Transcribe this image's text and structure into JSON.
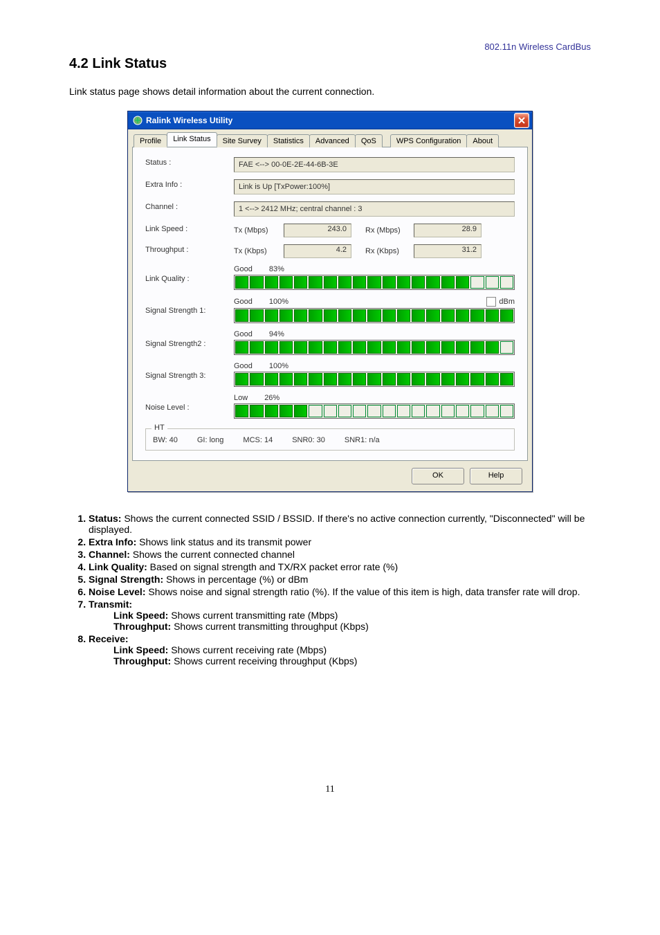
{
  "page": {
    "header": "802.11n Wireless CardBus",
    "section_title": "4.2 Link Status",
    "intro": "Link status page shows detail information about the current connection.",
    "page_number": "11"
  },
  "dialog": {
    "title": "Ralink Wireless Utility",
    "tabs": {
      "profile": "Profile",
      "link_status": "Link Status",
      "site_survey": "Site Survey",
      "statistics": "Statistics",
      "advanced": "Advanced",
      "qos": "QoS",
      "wps": "WPS Configuration",
      "about": "About"
    },
    "labels": {
      "status": "Status :",
      "extra": "Extra Info :",
      "channel": "Channel :",
      "linkspeed": "Link Speed :",
      "throughput": "Throughput :",
      "quality": "Link Quality :",
      "ss1": "Signal Strength 1:",
      "ss2": "Signal Strength2 :",
      "ss3": "Signal Strength 3:",
      "noise": "Noise Level :",
      "tx_mbps": "Tx (Mbps)",
      "rx_mbps": "Rx (Mbps)",
      "tx_kbps": "Tx (Kbps)",
      "rx_kbps": "Rx (Kbps)",
      "dbm": "dBm"
    },
    "values": {
      "status": "FAE <--> 00-0E-2E-44-6B-3E",
      "extra": "Link is Up [TxPower:100%]",
      "channel": "1 <--> 2412 MHz; central channel : 3",
      "tx_mbps": "243.0",
      "rx_mbps": "28.9",
      "tx_kbps": "4.2",
      "rx_kbps": "31.2"
    },
    "bars": {
      "quality": {
        "word": "Good",
        "pct": "83%"
      },
      "ss1": {
        "word": "Good",
        "pct": "100%"
      },
      "ss2": {
        "word": "Good",
        "pct": "94%"
      },
      "ss3": {
        "word": "Good",
        "pct": "100%"
      },
      "noise": {
        "word": "Low",
        "pct": "26%"
      }
    },
    "ht": {
      "legend": "HT",
      "bw": "BW: 40",
      "gi": "GI: long",
      "mcs": "MCS: 14",
      "snr0": "SNR0: 30",
      "snr1": "SNR1: n/a"
    },
    "buttons": {
      "ok": "OK",
      "help": "Help"
    }
  },
  "chart_data": {
    "type": "bar",
    "total_segments": 19,
    "series": [
      {
        "name": "Link Quality",
        "word": "Good",
        "percent": 83,
        "filled_segments": 16
      },
      {
        "name": "Signal Strength 1",
        "word": "Good",
        "percent": 100,
        "filled_segments": 19
      },
      {
        "name": "Signal Strength 2",
        "word": "Good",
        "percent": 94,
        "filled_segments": 18
      },
      {
        "name": "Signal Strength 3",
        "word": "Good",
        "percent": 100,
        "filled_segments": 19
      },
      {
        "name": "Noise Level",
        "word": "Low",
        "percent": 26,
        "filled_segments": 5
      }
    ]
  },
  "list": {
    "i1_b": "Status:",
    "i1_t": " Shows the current connected SSID / BSSID. If there's no active connection currently, \"Disconnected\" will be displayed.",
    "i2_b": "Extra Info:",
    "i2_t": " Shows link status and its transmit power",
    "i3_b": "Channel:",
    "i3_t": " Shows the current connected channel",
    "i4_b": "Link Quality:",
    "i4_t": " Based on signal strength and TX/RX packet error rate (%)",
    "i5_b": "Signal Strength:",
    "i5_t": " Shows in percentage (%) or dBm",
    "i6_b": "Noise Level:",
    "i6_t": " Shows noise and signal strength ratio (%). If the value of this item is high, data transfer rate will drop.",
    "i7_b": "Transmit:",
    "i7_ls_b": "Link Speed:",
    "i7_ls_t": " Shows current transmitting rate (Mbps)",
    "i7_tp_b": "Throughput:",
    "i7_tp_t": " Shows current transmitting throughput (Kbps)",
    "i8_b": "Receive:",
    "i8_ls_b": "Link Speed:",
    "i8_ls_t": " Shows current receiving rate (Mbps)",
    "i8_tp_b": "Throughput:",
    "i8_tp_t": " Shows current receiving throughput (Kbps)"
  }
}
